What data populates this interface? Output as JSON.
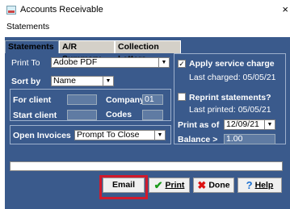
{
  "window": {
    "title": "Accounts Receivable",
    "close_glyph": "×"
  },
  "menu": {
    "statements": "Statements"
  },
  "tabs": [
    {
      "label": "Statements"
    },
    {
      "label": "A/R Summary"
    },
    {
      "label": "Collection Letters"
    }
  ],
  "form": {
    "print_to_label": "Print To",
    "print_to_value": "Adobe PDF",
    "sort_by_label": "Sort by",
    "sort_by_value": "Name",
    "for_client_label": "For client",
    "company_label": "Company",
    "company_value": "01",
    "start_client_label": "Start client",
    "codes_label": "Codes",
    "open_invoices_label": "Open Invoices",
    "open_invoices_value": "Prompt To Close",
    "apply_service_label": "Apply service charge",
    "apply_service_checked": "✓",
    "last_charged": "Last charged: 05/05/21",
    "reprint_label": "Reprint statements?",
    "last_printed": "Last printed: 05/05/21",
    "print_as_of_label": "Print as of",
    "print_as_of_value": "12/09/21",
    "balance_label": "Balance >",
    "balance_value": "1.00"
  },
  "buttons": {
    "email": "Email",
    "print": "Print",
    "done": "Done",
    "help": "Help"
  },
  "colors": {
    "panel_bg": "#3a5a8c",
    "highlight": "#d21a2c"
  }
}
